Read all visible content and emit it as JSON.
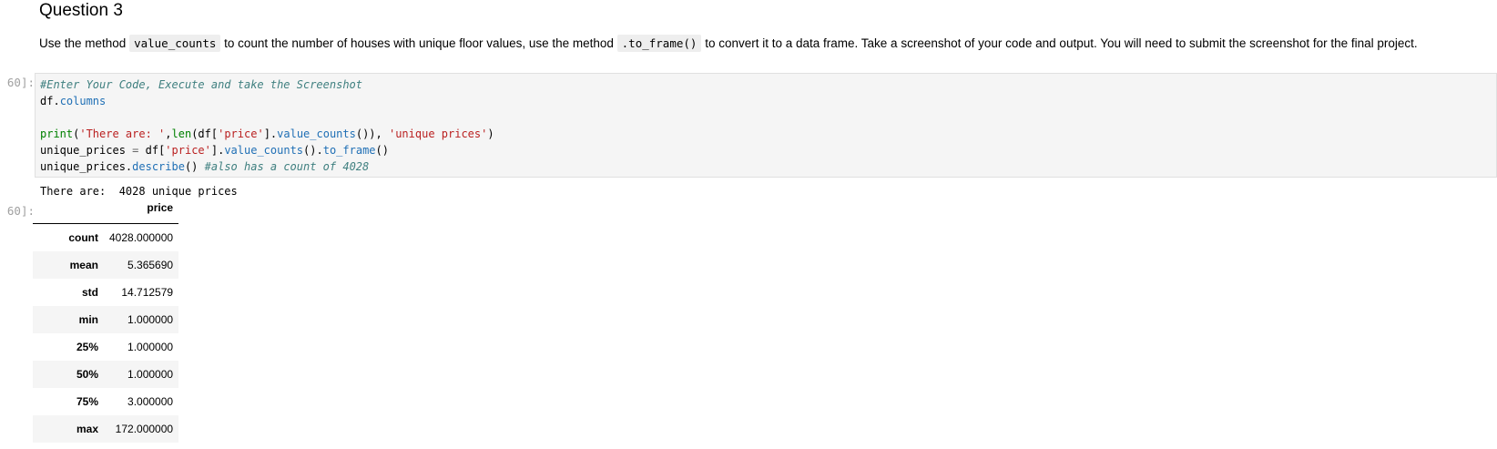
{
  "markdown": {
    "heading": "Question 3",
    "para_part1": "Use the method ",
    "code1": "value_counts",
    "para_part2": " to count the number of houses with unique floor values, use the method ",
    "code2": ".to_frame()",
    "para_part3": " to convert it to a data frame. Take a screenshot of your code and output. You will need to submit the screenshot for the final project."
  },
  "cell": {
    "in_prompt": "60]:",
    "out_prompt": "60]:",
    "code": {
      "line1_comment": "#Enter Your Code, Execute and take the Screenshot",
      "line2_obj": "df",
      "line2_dot": ".",
      "line2_attr": "columns",
      "line4_print": "print",
      "line4_open": "(",
      "line4_str1": "'There are: '",
      "line4_comma": ",",
      "line4_len": "len",
      "line4_mid": "(df[",
      "line4_str2": "'price'",
      "line4_close_br": "].",
      "line4_vc": "value_counts",
      "line4_tail": "()), ",
      "line4_str3": "'unique prices'",
      "line4_end": ")",
      "line5_var": "unique_prices ",
      "line5_eq": "=",
      "line5_df": " df[",
      "line5_str": "'price'",
      "line5_br": "].",
      "line5_vc": "value_counts",
      "line5_mid": "().",
      "line5_tf": "to_frame",
      "line5_end": "()",
      "line6_var": "unique_prices.",
      "line6_desc": "describe",
      "line6_paren": "() ",
      "line6_comment": "#also has a count of 4028"
    },
    "stream_output": "There are:  4028 unique prices"
  },
  "table": {
    "column_header": "price",
    "rows": [
      {
        "index": "count",
        "value": "4028.000000"
      },
      {
        "index": "mean",
        "value": "5.365690"
      },
      {
        "index": "std",
        "value": "14.712579"
      },
      {
        "index": "min",
        "value": "1.000000"
      },
      {
        "index": "25%",
        "value": "1.000000"
      },
      {
        "index": "50%",
        "value": "1.000000"
      },
      {
        "index": "75%",
        "value": "3.000000"
      },
      {
        "index": "max",
        "value": "172.000000"
      }
    ]
  }
}
